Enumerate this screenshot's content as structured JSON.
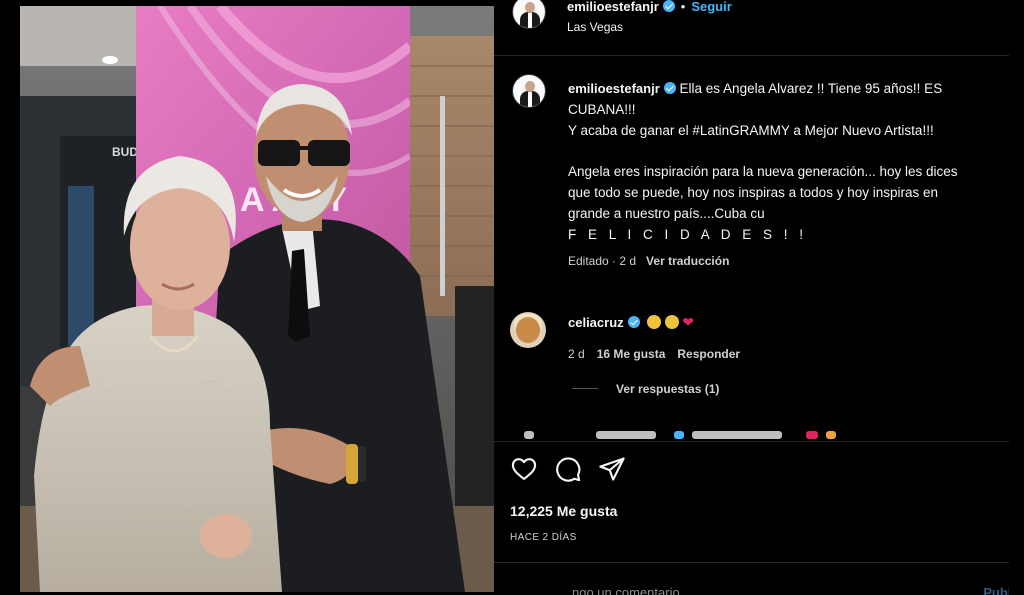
{
  "post": {
    "username": "emilioestefanjr",
    "follow_label": "Seguir",
    "location": "Las Vegas",
    "separator": "•"
  },
  "caption": {
    "username": "emilioestefanjr",
    "line1": "Ella es Angela Alvarez !! Tiene 95 años!! ES",
    "line2": "CUBANA!!!",
    "line3": "Y acaba de ganar el #LatinGRAMMY a Mejor Nuevo Artista!!!",
    "line4": "Angela eres inspiración para la nueva generación... hoy les dices",
    "line5": "que todo se puede, hoy nos inspiras a todos y hoy inspiras en",
    "line6": "grande a nuestro país....Cuba cu",
    "felicidades": "F E L I C I D A D E S ! !",
    "edited": "Editado · 2 d",
    "translate": "Ver traducción"
  },
  "comment": {
    "username": "celiacruz",
    "time": "2 d",
    "likes": "16 Me gusta",
    "reply_label": "Responder"
  },
  "view_replies": "Ver respuestas (1)",
  "engagement": {
    "likes": "12,225 Me gusta",
    "posted": "HACE 2 DÍAS"
  },
  "icons": {
    "like": "heart-icon",
    "comment": "comment-icon",
    "share": "share-icon"
  },
  "colors": {
    "background": "#000000",
    "accent": "#4cb5f9",
    "heart": "#e0245e"
  },
  "photo": {
    "banner_letters": "A  AMY",
    "sponsor": "BUD"
  },
  "add_comment": {
    "placeholder": "ngo un comentario...",
    "publish": "Publi"
  }
}
